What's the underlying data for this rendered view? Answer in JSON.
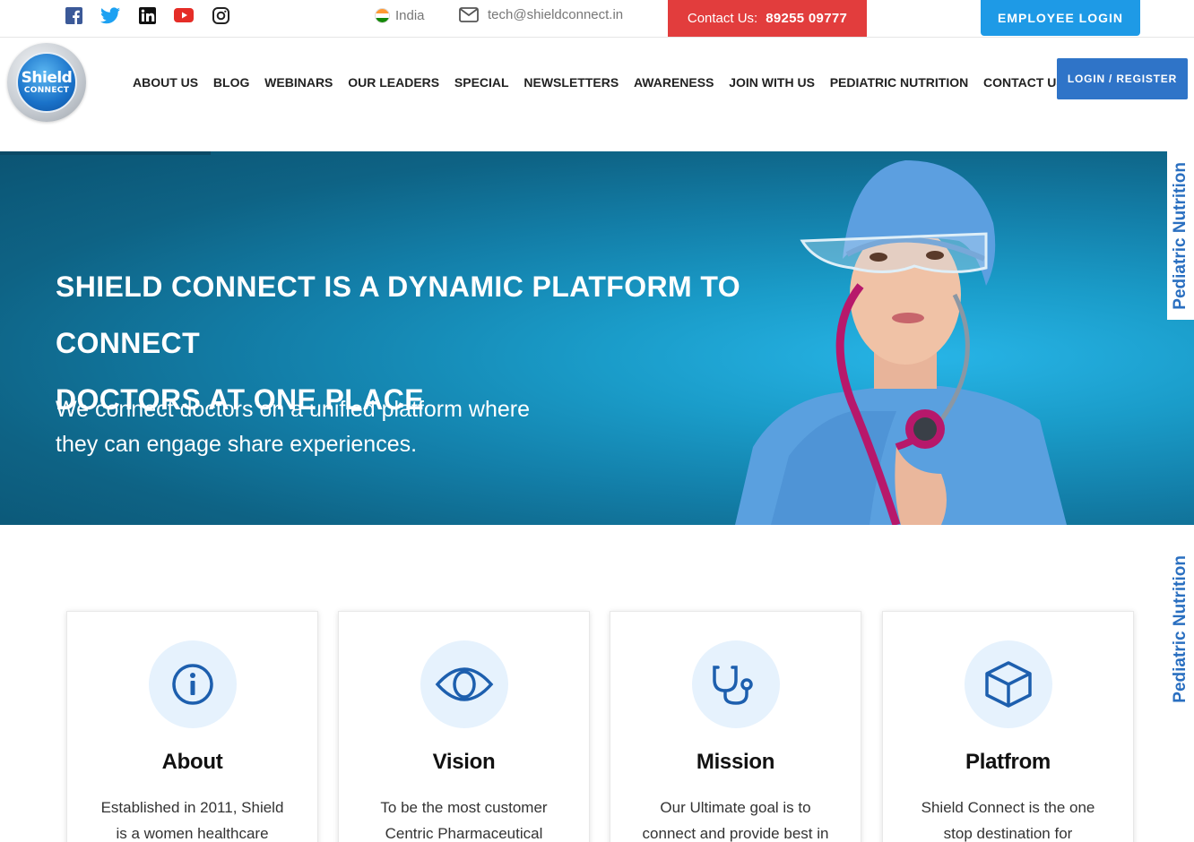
{
  "topbar": {
    "social": [
      "facebook-icon",
      "twitter-icon",
      "linkedin-icon",
      "youtube-icon",
      "instagram-icon"
    ],
    "country": "India",
    "email": "tech@shieldconnect.in",
    "contact_label": "Contact Us:",
    "contact_number": "89255 09777",
    "employee_login": "EMPLOYEE LOGIN"
  },
  "logo": {
    "line1": "Shield",
    "line2": "CONNECT"
  },
  "nav": {
    "items": [
      "ABOUT US",
      "BLOG",
      "WEBINARS",
      "OUR LEADERS",
      "SPECIAL",
      "NEWSLETTERS",
      "AWARENESS",
      "JOIN WITH US",
      "PEDIATRIC NUTRITION",
      "CONTACT US"
    ],
    "login_register": "LOGIN / REGISTER"
  },
  "hero": {
    "title_line1": "SHIELD CONNECT IS A DYNAMIC PLATFORM TO CONNECT",
    "title_line2": "DOCTORS AT ONE PLACE",
    "subtitle_line1": "We connect doctors on a unified platform where",
    "subtitle_line2": "they can engage share experiences."
  },
  "side_tab": {
    "label": "Pediatric Nutrition"
  },
  "cards": [
    {
      "icon": "info-icon",
      "title": "About",
      "line1": "Established in 2011, Shield",
      "line2": "is a women healthcare"
    },
    {
      "icon": "eye-icon",
      "title": "Vision",
      "line1": "To be the most customer",
      "line2": "Centric Pharmaceutical"
    },
    {
      "icon": "stethoscope-icon",
      "title": "Mission",
      "line1": "Our Ultimate goal is to",
      "line2": "connect and provide best in"
    },
    {
      "icon": "box-icon",
      "title": "Platfrom",
      "line1": "Shield Connect is the one",
      "line2": "stop destination for"
    }
  ],
  "colors": {
    "contact_red": "#e23d3d",
    "employee_blue": "#1e9ae6",
    "login_blue": "#2f74c8",
    "hero_teal": "#137fa9",
    "icon_blue": "#1d5fae",
    "icon_bg": "#e6f2fd"
  }
}
